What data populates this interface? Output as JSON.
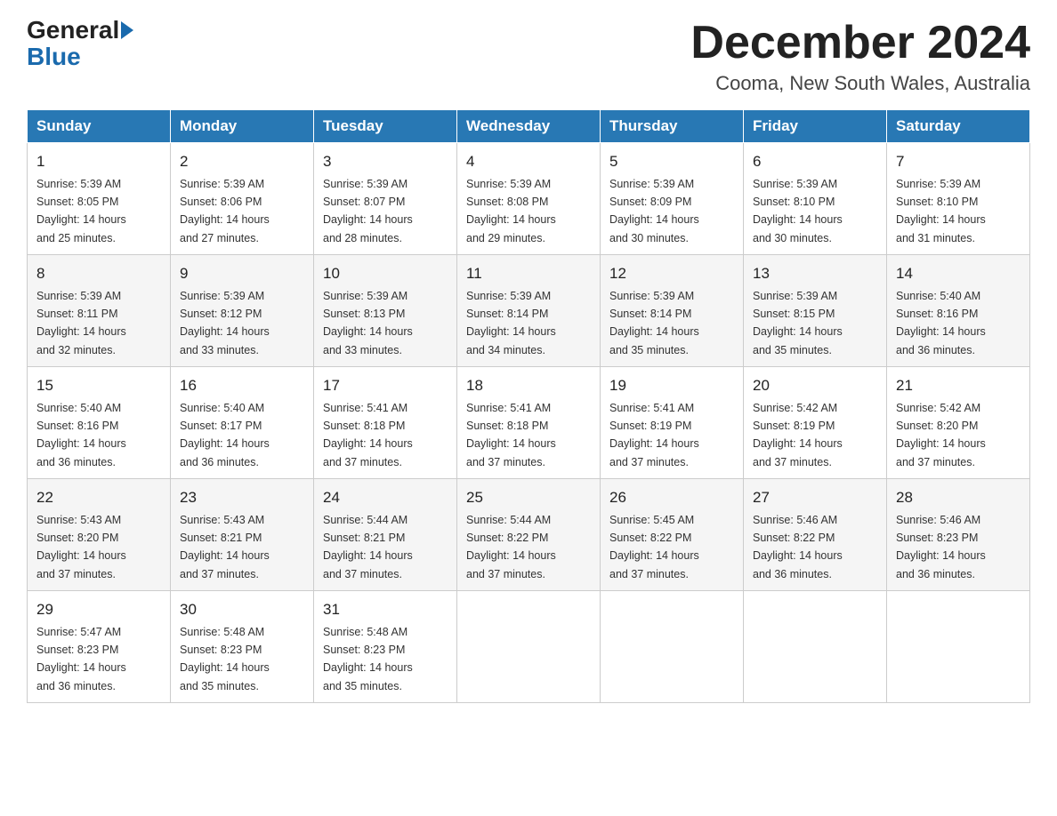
{
  "header": {
    "logo_general": "General",
    "logo_blue": "Blue",
    "month_title": "December 2024",
    "location": "Cooma, New South Wales, Australia"
  },
  "weekdays": [
    "Sunday",
    "Monday",
    "Tuesday",
    "Wednesday",
    "Thursday",
    "Friday",
    "Saturday"
  ],
  "weeks": [
    [
      {
        "day": "1",
        "sunrise": "5:39 AM",
        "sunset": "8:05 PM",
        "daylight": "14 hours and 25 minutes."
      },
      {
        "day": "2",
        "sunrise": "5:39 AM",
        "sunset": "8:06 PM",
        "daylight": "14 hours and 27 minutes."
      },
      {
        "day": "3",
        "sunrise": "5:39 AM",
        "sunset": "8:07 PM",
        "daylight": "14 hours and 28 minutes."
      },
      {
        "day": "4",
        "sunrise": "5:39 AM",
        "sunset": "8:08 PM",
        "daylight": "14 hours and 29 minutes."
      },
      {
        "day": "5",
        "sunrise": "5:39 AM",
        "sunset": "8:09 PM",
        "daylight": "14 hours and 30 minutes."
      },
      {
        "day": "6",
        "sunrise": "5:39 AM",
        "sunset": "8:10 PM",
        "daylight": "14 hours and 30 minutes."
      },
      {
        "day": "7",
        "sunrise": "5:39 AM",
        "sunset": "8:10 PM",
        "daylight": "14 hours and 31 minutes."
      }
    ],
    [
      {
        "day": "8",
        "sunrise": "5:39 AM",
        "sunset": "8:11 PM",
        "daylight": "14 hours and 32 minutes."
      },
      {
        "day": "9",
        "sunrise": "5:39 AM",
        "sunset": "8:12 PM",
        "daylight": "14 hours and 33 minutes."
      },
      {
        "day": "10",
        "sunrise": "5:39 AM",
        "sunset": "8:13 PM",
        "daylight": "14 hours and 33 minutes."
      },
      {
        "day": "11",
        "sunrise": "5:39 AM",
        "sunset": "8:14 PM",
        "daylight": "14 hours and 34 minutes."
      },
      {
        "day": "12",
        "sunrise": "5:39 AM",
        "sunset": "8:14 PM",
        "daylight": "14 hours and 35 minutes."
      },
      {
        "day": "13",
        "sunrise": "5:39 AM",
        "sunset": "8:15 PM",
        "daylight": "14 hours and 35 minutes."
      },
      {
        "day": "14",
        "sunrise": "5:40 AM",
        "sunset": "8:16 PM",
        "daylight": "14 hours and 36 minutes."
      }
    ],
    [
      {
        "day": "15",
        "sunrise": "5:40 AM",
        "sunset": "8:16 PM",
        "daylight": "14 hours and 36 minutes."
      },
      {
        "day": "16",
        "sunrise": "5:40 AM",
        "sunset": "8:17 PM",
        "daylight": "14 hours and 36 minutes."
      },
      {
        "day": "17",
        "sunrise": "5:41 AM",
        "sunset": "8:18 PM",
        "daylight": "14 hours and 37 minutes."
      },
      {
        "day": "18",
        "sunrise": "5:41 AM",
        "sunset": "8:18 PM",
        "daylight": "14 hours and 37 minutes."
      },
      {
        "day": "19",
        "sunrise": "5:41 AM",
        "sunset": "8:19 PM",
        "daylight": "14 hours and 37 minutes."
      },
      {
        "day": "20",
        "sunrise": "5:42 AM",
        "sunset": "8:19 PM",
        "daylight": "14 hours and 37 minutes."
      },
      {
        "day": "21",
        "sunrise": "5:42 AM",
        "sunset": "8:20 PM",
        "daylight": "14 hours and 37 minutes."
      }
    ],
    [
      {
        "day": "22",
        "sunrise": "5:43 AM",
        "sunset": "8:20 PM",
        "daylight": "14 hours and 37 minutes."
      },
      {
        "day": "23",
        "sunrise": "5:43 AM",
        "sunset": "8:21 PM",
        "daylight": "14 hours and 37 minutes."
      },
      {
        "day": "24",
        "sunrise": "5:44 AM",
        "sunset": "8:21 PM",
        "daylight": "14 hours and 37 minutes."
      },
      {
        "day": "25",
        "sunrise": "5:44 AM",
        "sunset": "8:22 PM",
        "daylight": "14 hours and 37 minutes."
      },
      {
        "day": "26",
        "sunrise": "5:45 AM",
        "sunset": "8:22 PM",
        "daylight": "14 hours and 37 minutes."
      },
      {
        "day": "27",
        "sunrise": "5:46 AM",
        "sunset": "8:22 PM",
        "daylight": "14 hours and 36 minutes."
      },
      {
        "day": "28",
        "sunrise": "5:46 AM",
        "sunset": "8:23 PM",
        "daylight": "14 hours and 36 minutes."
      }
    ],
    [
      {
        "day": "29",
        "sunrise": "5:47 AM",
        "sunset": "8:23 PM",
        "daylight": "14 hours and 36 minutes."
      },
      {
        "day": "30",
        "sunrise": "5:48 AM",
        "sunset": "8:23 PM",
        "daylight": "14 hours and 35 minutes."
      },
      {
        "day": "31",
        "sunrise": "5:48 AM",
        "sunset": "8:23 PM",
        "daylight": "14 hours and 35 minutes."
      },
      null,
      null,
      null,
      null
    ]
  ],
  "labels": {
    "sunrise_label": "Sunrise:",
    "sunset_label": "Sunset:",
    "daylight_label": "Daylight:"
  }
}
